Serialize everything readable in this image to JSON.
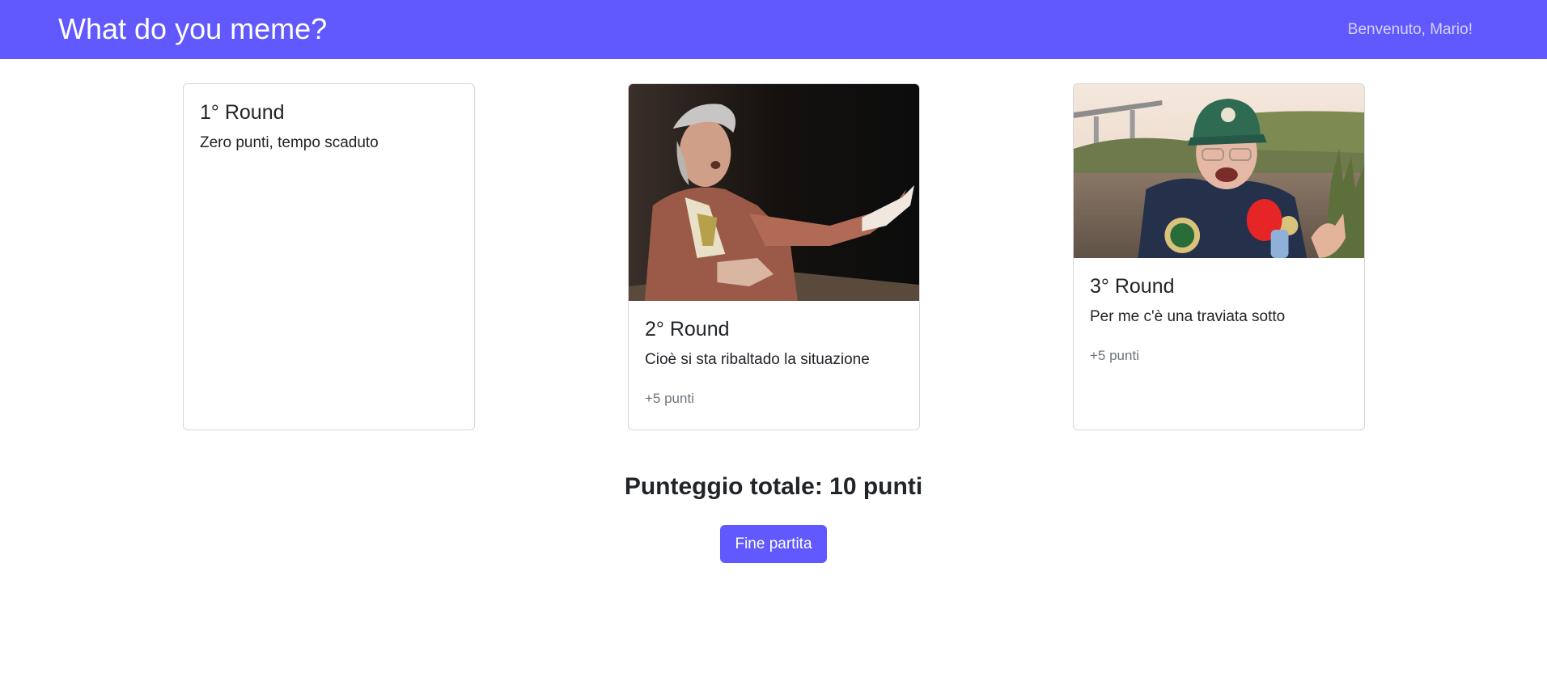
{
  "navbar": {
    "brand": "What do you meme?",
    "welcome": "Benvenuto, Mario!"
  },
  "rounds": [
    {
      "title": "1° Round",
      "text": "Zero punti, tempo scaduto",
      "points": "",
      "image": "none"
    },
    {
      "title": "2° Round",
      "text": "Cioè si sta ribaltado la situazione",
      "points": "+5 punti",
      "image": "meme-actor-on-stage"
    },
    {
      "title": "3° Round",
      "text": "Per me c'è una traviata sotto",
      "points": "+5 punti",
      "image": "meme-man-with-microphone-by-river"
    }
  ],
  "summary": {
    "total": "Punteggio totale: 10 punti",
    "end_button": "Fine partita"
  },
  "colors": {
    "accent": "#6159fd",
    "welcome_text": "#d3d0ff",
    "muted": "#6c757d"
  }
}
